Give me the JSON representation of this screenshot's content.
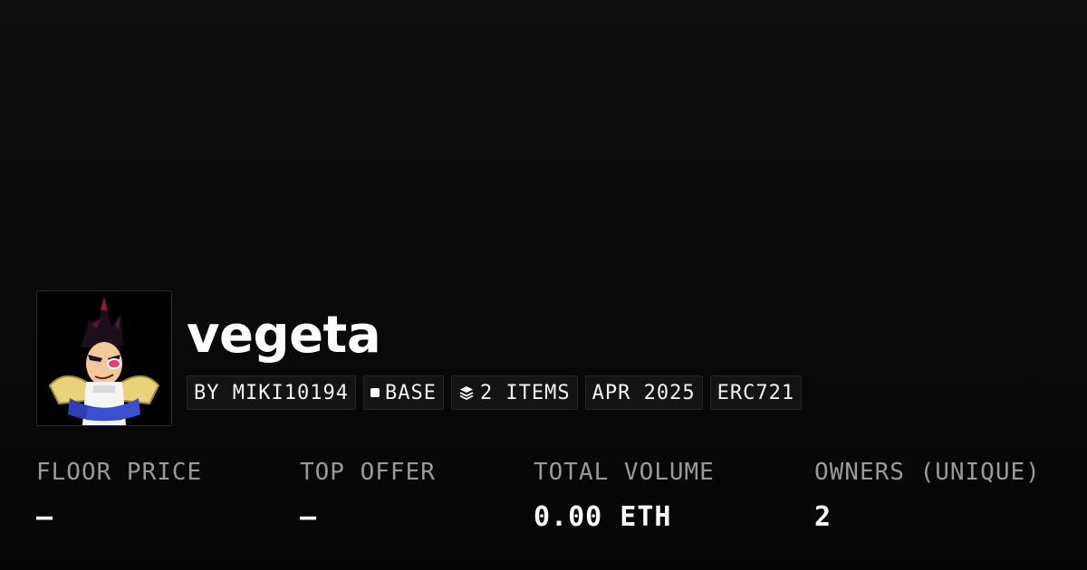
{
  "collection": {
    "name": "vegeta",
    "avatar": {
      "subject": "vegeta-character-art"
    },
    "tags": {
      "creator": "BY MIKI10194",
      "chain": "BASE",
      "chain_icon": "square-icon",
      "items": "2 ITEMS",
      "items_icon": "layers-icon",
      "date": "APR 2025",
      "standard": "ERC721"
    }
  },
  "stats": [
    {
      "label": "FLOOR PRICE",
      "value": "–"
    },
    {
      "label": "TOP OFFER",
      "value": "–"
    },
    {
      "label": "TOTAL VOLUME",
      "value": "0.00 ETH"
    },
    {
      "label": "OWNERS (UNIQUE)",
      "value": "2"
    }
  ]
}
